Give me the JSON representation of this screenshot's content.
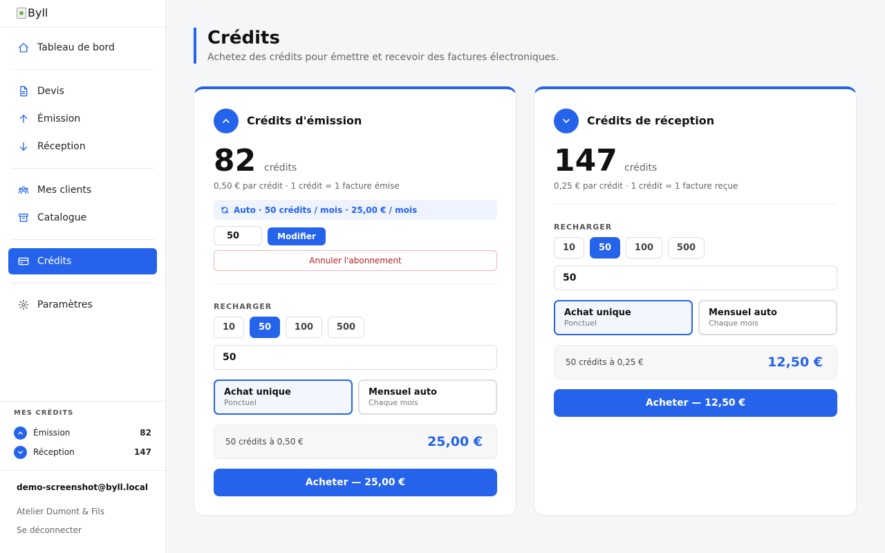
{
  "app": {
    "logo_alt": "Byll"
  },
  "sidebar": {
    "nav": [
      {
        "label": "Tableau de bord",
        "icon": "home-icon"
      },
      {
        "label": "Devis",
        "icon": "document-icon"
      },
      {
        "label": "Émission",
        "icon": "arrow-up-icon"
      },
      {
        "label": "Réception",
        "icon": "arrow-down-icon"
      },
      {
        "label": "Mes clients",
        "icon": "users-icon"
      },
      {
        "label": "Catalogue",
        "icon": "archive-icon"
      },
      {
        "label": "Crédits",
        "icon": "credit-card-icon",
        "active": true
      },
      {
        "label": "Paramètres",
        "icon": "gear-icon"
      }
    ],
    "credits_title": "MES CRÉDITS",
    "credits": [
      {
        "label": "Émission",
        "value": "82"
      },
      {
        "label": "Réception",
        "value": "147"
      }
    ],
    "user": {
      "email": "demo-screenshot@byll.local",
      "company": "Atelier Dumont & Fils",
      "logout": "Se déconnecter"
    }
  },
  "header": {
    "title": "Crédits",
    "subtitle": "Achetez des crédits pour émettre et recevoir des factures électroniques."
  },
  "emission": {
    "title": "Crédits d'émission",
    "balance": "82",
    "unit": "crédits",
    "price_note": "0,50 € par crédit · 1 crédit = 1 facture émise",
    "subscription": "Auto · 50 crédits / mois · 25,00 € / mois",
    "sub_qty": "50",
    "modify_label": "Modifier",
    "cancel_label": "Annuler l'abonnement",
    "recharge_label": "RECHARGER",
    "packs": [
      "10",
      "50",
      "100",
      "500"
    ],
    "selected_pack": "50",
    "amount": "50",
    "modes": [
      {
        "title": "Achat unique",
        "sub": "Ponctuel"
      },
      {
        "title": "Mensuel auto",
        "sub": "Chaque mois"
      }
    ],
    "summary_text": "50 crédits à 0,50 €",
    "summary_total": "25,00 €",
    "buy_label": "Acheter — 25,00 €"
  },
  "reception": {
    "title": "Crédits de réception",
    "balance": "147",
    "unit": "crédits",
    "price_note": "0,25 € par crédit · 1 crédit = 1 facture reçue",
    "recharge_label": "RECHARGER",
    "packs": [
      "10",
      "50",
      "100",
      "500"
    ],
    "selected_pack": "50",
    "amount": "50",
    "modes": [
      {
        "title": "Achat unique",
        "sub": "Ponctuel"
      },
      {
        "title": "Mensuel auto",
        "sub": "Chaque mois"
      }
    ],
    "summary_text": "50 crédits à 0,25 €",
    "summary_total": "12,50 €",
    "buy_label": "Acheter — 12,50 €"
  },
  "colors": {
    "accent": "#2563eb",
    "danger": "#b91c1c"
  }
}
